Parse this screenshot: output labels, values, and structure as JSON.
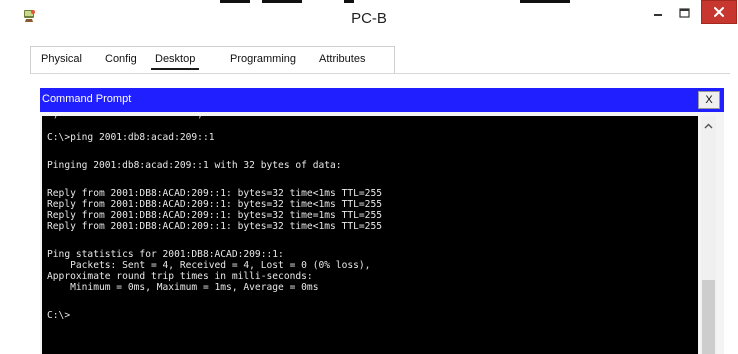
{
  "window": {
    "title": "PC-B",
    "close_color": "#c7372f",
    "icons": {
      "app": "packet-tracer-pc-icon",
      "minimize": "minimize-icon",
      "maximize": "maximize-icon",
      "close": "close-icon"
    }
  },
  "tabs": [
    {
      "label": "Physical",
      "active": false
    },
    {
      "label": "Config",
      "active": false
    },
    {
      "label": "Desktop",
      "active": true
    },
    {
      "label": "Programming",
      "active": false
    },
    {
      "label": "Attributes",
      "active": false
    }
  ],
  "command_prompt": {
    "title": "Command Prompt",
    "close_label": "X",
    "header_color": "#1f1fff",
    "lines": [
      "C:\\>ping 2001:db8:acad:209::1",
      "Pinging 2001:db8:acad:209::1 with 32 bytes of data:",
      "Reply from 2001:DB8:ACAD:209::1: bytes=32 time<1ms TTL=255",
      "Reply from 2001:DB8:ACAD:209::1: bytes=32 time<1ms TTL=255",
      "Reply from 2001:DB8:ACAD:209::1: bytes=32 time=1ms TTL=255",
      "Reply from 2001:DB8:ACAD:209::1: bytes=32 time<1ms TTL=255",
      "Ping statistics for 2001:DB8:ACAD:209::1:",
      "    Packets: Sent = 4, Received = 4, Lost = 0 (0% loss),",
      "Approximate round trip times in milli-seconds:",
      "    Minimum = 0ms, Maximum = 1ms, Average = 0ms",
      "C:\\>"
    ]
  },
  "scrollbar": {
    "icon": "scroll-up-arrow-icon"
  }
}
